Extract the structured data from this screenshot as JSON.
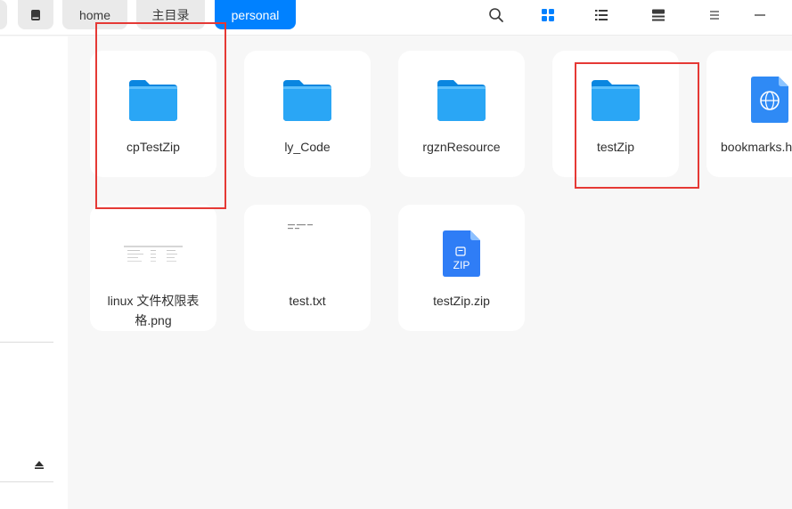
{
  "breadcrumbs": [
    {
      "label": "home",
      "active": false
    },
    {
      "label": "主目录",
      "active": false
    },
    {
      "label": "personal",
      "active": true
    }
  ],
  "toolbar_icons": [
    "search-icon",
    "icon-view-icon",
    "list-view-icon",
    "detail-view-icon",
    "menu-icon",
    "minimize-icon"
  ],
  "colors": {
    "accent": "#0081ff",
    "folder": "#1a9cf2",
    "highlight": "#e53935"
  },
  "files": [
    {
      "name": "cpTestZip",
      "type": "folder"
    },
    {
      "name": "ly_Code",
      "type": "folder"
    },
    {
      "name": "rgznResource",
      "type": "folder"
    },
    {
      "name": "testZip",
      "type": "folder"
    },
    {
      "name": "bookmarks.h",
      "type": "html"
    },
    {
      "name": "linux 文件权限表格.png",
      "type": "image"
    },
    {
      "name": "test.txt",
      "type": "text"
    },
    {
      "name": "testZip.zip",
      "type": "zip"
    }
  ],
  "zip_badge": "ZIP"
}
